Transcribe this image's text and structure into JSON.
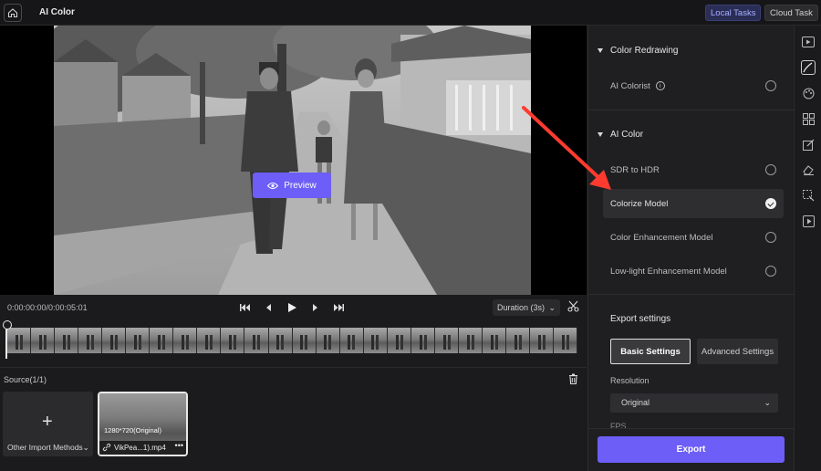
{
  "header": {
    "title": "AI Color",
    "local_tasks": "Local Tasks",
    "cloud_task": "Cloud Task"
  },
  "player": {
    "preview_label": "Preview",
    "timecode": "0:00:00:00/0:00:05:01",
    "duration_label": "Duration (3s)"
  },
  "source": {
    "label": "Source(1/1)",
    "import_label": "Other Import Methods",
    "media": {
      "resolution": "1280*720(Original)",
      "filename": "VikPea...1).mp4"
    }
  },
  "panel": {
    "color_redrawing": {
      "title": "Color Redrawing",
      "options": [
        {
          "label": "AI Colorist",
          "selected": false
        }
      ]
    },
    "ai_color": {
      "title": "AI Color",
      "options": [
        {
          "label": "SDR to HDR",
          "selected": false
        },
        {
          "label": "Colorize Model",
          "selected": true
        },
        {
          "label": "Color Enhancement Model",
          "selected": false
        },
        {
          "label": "Low-light Enhancement Model",
          "selected": false
        }
      ]
    },
    "export": {
      "title": "Export settings",
      "basic_tab": "Basic Settings",
      "advanced_tab": "Advanced Settings",
      "resolution_label": "Resolution",
      "resolution_value": "Original",
      "fps_label": "FPS",
      "export_button": "Export"
    }
  },
  "colors": {
    "accent": "#6c5ef6",
    "arrow": "#ff3b30",
    "local_tasks_bg": "#2a2d55"
  },
  "tools": [
    "video-icon",
    "brush-icon",
    "color-palette-icon",
    "layout-icon",
    "edit-icon",
    "eraser-icon",
    "select-icon",
    "play-square-icon"
  ]
}
